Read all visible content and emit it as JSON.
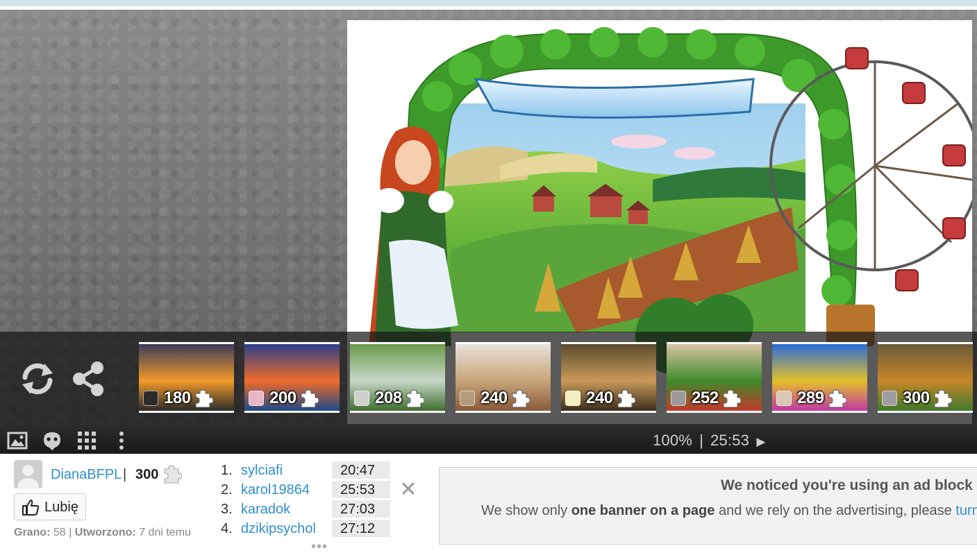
{
  "thumbnails": [
    {
      "count": "180",
      "scene": "sunset-car"
    },
    {
      "count": "200",
      "scene": "boat-sunset"
    },
    {
      "count": "208",
      "scene": "park"
    },
    {
      "count": "240",
      "scene": "food-board"
    },
    {
      "count": "240",
      "scene": "painting-children"
    },
    {
      "count": "252",
      "scene": "vegetables"
    },
    {
      "count": "289",
      "scene": "painted-face"
    },
    {
      "count": "300",
      "scene": "spices"
    }
  ],
  "toolbar": {
    "zoom": "100%",
    "separator": "|",
    "timer": "25:53",
    "play_symbol": "▶"
  },
  "author": {
    "name": "DianaBFPL",
    "pipe": "|",
    "pieces": "300",
    "like_label": "Lubię",
    "played_label": "Grano:",
    "played_value": "58",
    "created_sep": "|",
    "created_label": "Utworzono:",
    "created_value": "7 dni temu"
  },
  "ranking": {
    "rows": [
      {
        "pos": "1.",
        "name": "sylciafi",
        "time": "20:47"
      },
      {
        "pos": "2.",
        "name": "karol19864",
        "time": "25:53"
      },
      {
        "pos": "3.",
        "name": "karadok",
        "time": "27:03"
      },
      {
        "pos": "4.",
        "name": "dzikipsychol",
        "time": "27:12"
      }
    ],
    "more": "•••"
  },
  "close_symbol": "✕",
  "ad_notice": {
    "title": "We noticed you're using an ad block",
    "text_before": "We show only ",
    "text_bold": "one banner on a page",
    "text_after": " and we rely on the advertising, please ",
    "link": "turn"
  }
}
